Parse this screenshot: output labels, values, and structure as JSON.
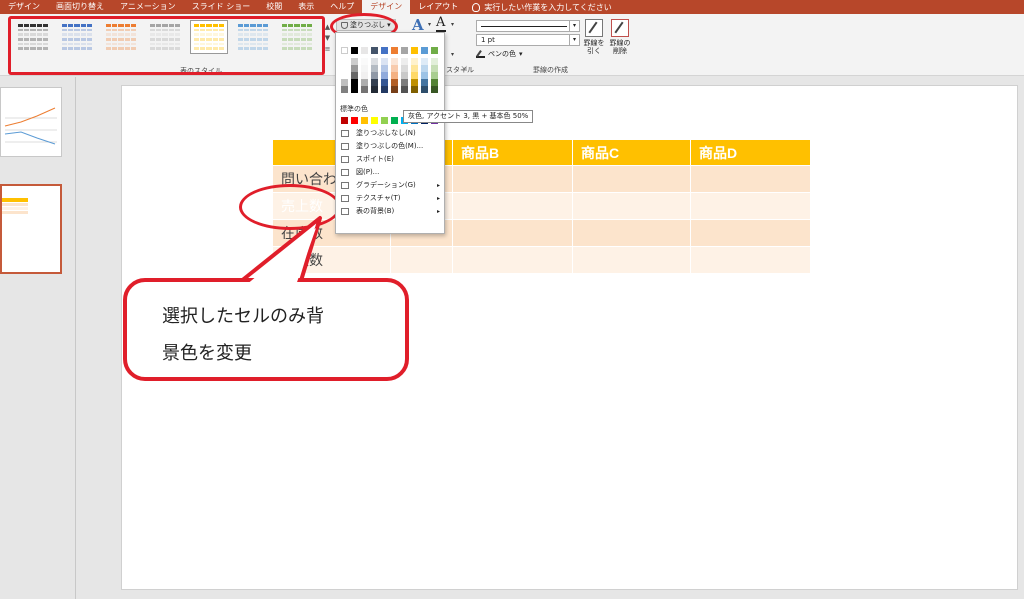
{
  "menubar": {
    "tabs": [
      "デザイン",
      "画面切り替え",
      "アニメーション",
      "スライド ショー",
      "校閲",
      "表示",
      "ヘルプ",
      "デザイン",
      "レイアウト"
    ],
    "tell_me": "実行したい作業を入力してください"
  },
  "ribbon": {
    "table_styles_label": "表のスタイル",
    "shading_button": "塗りつぶし",
    "wordart_label": "スタイル",
    "pen_weight": "1 pt",
    "pen_color": "ペンの色",
    "draw_table": "罫線を\n引く",
    "eraser": "罫線の\n削除",
    "borders_group_label": "罫線の作成",
    "style_colors": [
      "#333333",
      "#4472c4",
      "#ed7d31",
      "#a5a5a5",
      "#ffc000",
      "#5b9bd5",
      "#70ad47"
    ]
  },
  "table": {
    "headers": [
      "",
      "商品B",
      "商品C",
      "商品D"
    ],
    "row_labels": [
      "問い合わせ",
      "売上数",
      "在庫数",
      "注文数"
    ],
    "header_color": "#ffc000",
    "selected_cell_color": "#404040"
  },
  "callout": {
    "line1": "選択したセルのみ背",
    "line2": "景色を変更",
    "border_color": "#e01e2a"
  },
  "shading_menu": {
    "standard_colors_label": "標準の色",
    "theme_top_row": [
      "#ffffff",
      "#000000",
      "#e7e6e6",
      "#44546a",
      "#4472c4",
      "#ed7d31",
      "#a5a5a5",
      "#ffc000",
      "#5b9bd5",
      "#70ad47"
    ],
    "standard_colors": [
      "#c00000",
      "#ff0000",
      "#ffc000",
      "#ffff00",
      "#92d050",
      "#00b050",
      "#00b0f0",
      "#0070c0",
      "#002060",
      "#7030a0"
    ],
    "items": [
      {
        "label": "塗りつぶしなし(N)",
        "submenu": false
      },
      {
        "label": "塗りつぶしの色(M)...",
        "submenu": false
      },
      {
        "label": "スポイト(E)",
        "submenu": false
      },
      {
        "label": "図(P)...",
        "submenu": false
      },
      {
        "label": "グラデーション(G)",
        "submenu": true
      },
      {
        "label": "テクスチャ(T)",
        "submenu": true
      },
      {
        "label": "表の背景(B)",
        "submenu": true
      }
    ],
    "tooltip": "灰色, アクセント 3, 黒 + 基本色 50%"
  }
}
